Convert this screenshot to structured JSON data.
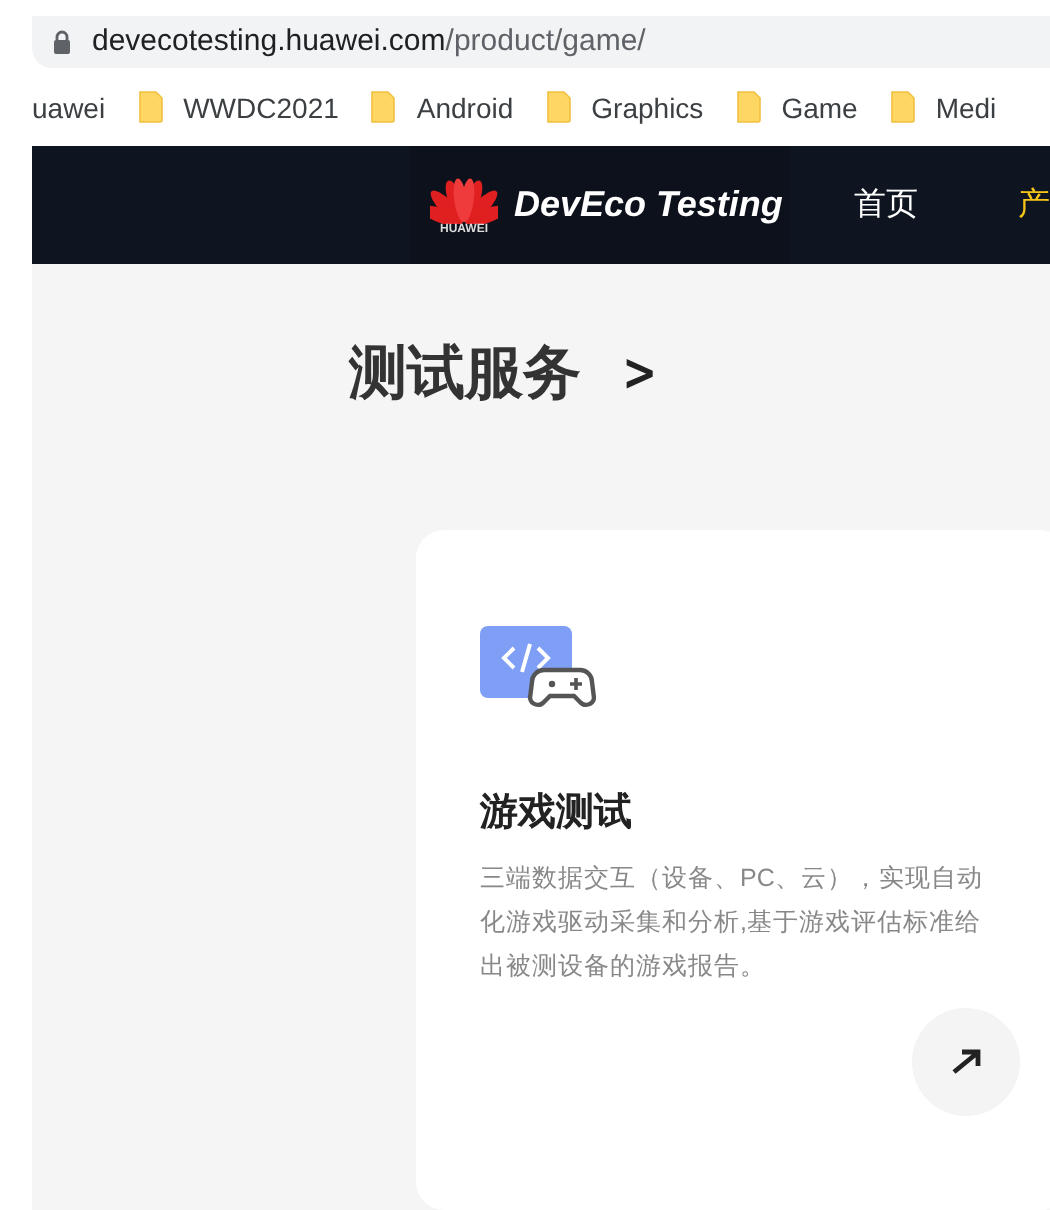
{
  "address_bar": {
    "host": "devecotesting.huawei.com",
    "path": "/product/game/"
  },
  "bookmarks": [
    {
      "label": "uawei",
      "kind": "text"
    },
    {
      "label": "WWDC2021",
      "kind": "folder"
    },
    {
      "label": "Android",
      "kind": "folder"
    },
    {
      "label": "Graphics",
      "kind": "folder"
    },
    {
      "label": "Game",
      "kind": "folder"
    },
    {
      "label": "Medi",
      "kind": "folder"
    }
  ],
  "header": {
    "logo_word": "HUAWEI",
    "brand": "DevEco Testing",
    "nav": [
      {
        "label": "首页",
        "selected": false
      },
      {
        "label": "产",
        "selected": true
      }
    ]
  },
  "section": {
    "title": "测试服务",
    "arrow": ">"
  },
  "card": {
    "title": "游戏测试",
    "description": "三端数据交互（设备、PC、云），实现自动化游戏驱动采集和分析,基于游戏评估标准给出被测设备的游戏报告。"
  }
}
